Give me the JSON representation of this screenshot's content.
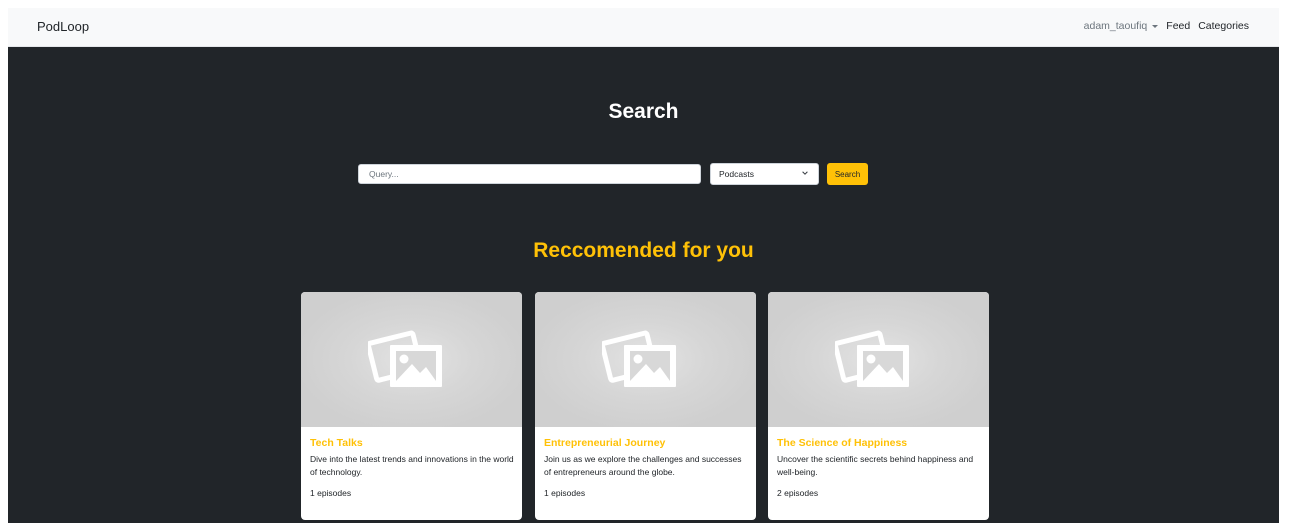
{
  "navbar": {
    "brand": "PodLoop",
    "user": "adam_taoufiq",
    "links": [
      "Feed",
      "Categories"
    ]
  },
  "search": {
    "title": "Search",
    "placeholder": "Query...",
    "type_selected": "Podcasts",
    "button_label": "Search"
  },
  "recommended": {
    "title": "Reccomended for you",
    "cards": [
      {
        "title": "Tech Talks",
        "description": "Dive into the latest trends and innovations in the world of technology.",
        "episodes": "1 episodes",
        "image_icon": "image-placeholder-icon"
      },
      {
        "title": "Entrepreneurial Journey",
        "description": "Join us as we explore the challenges and successes of entrepreneurs around the globe.",
        "episodes": "1 episodes",
        "image_icon": "image-placeholder-icon"
      },
      {
        "title": "The Science of Happiness",
        "description": "Uncover the scientific secrets behind happiness and well-being.",
        "episodes": "2 episodes",
        "image_icon": "image-placeholder-icon"
      }
    ]
  },
  "colors": {
    "accent": "#ffc107",
    "dark_background": "#212529",
    "navbar_background": "#f8f9fa",
    "card_image_background": "#d6d6d6"
  }
}
